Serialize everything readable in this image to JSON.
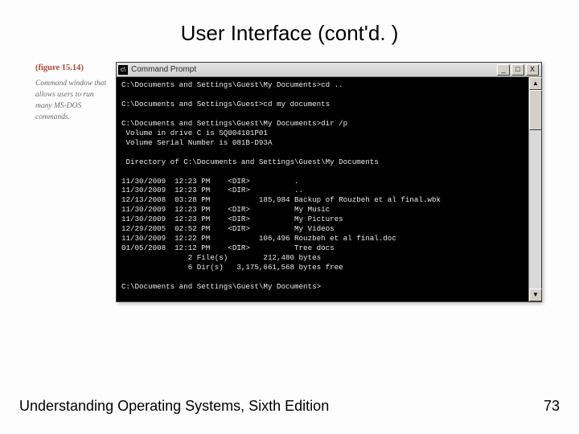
{
  "slide": {
    "title": "User Interface (cont'd. )",
    "footer_left": "Understanding Operating Systems, Sixth Edition",
    "footer_right": "73"
  },
  "figure": {
    "number": "(figure 15.14)",
    "caption": "Command window that allows users to run many MS-DOS commands."
  },
  "window": {
    "icon_glyph": "c\\",
    "title": "Command Prompt",
    "btn_min": "_",
    "btn_max": "□",
    "btn_close": "X",
    "scroll_up": "▲",
    "scroll_down": "▼"
  },
  "terminal": {
    "text": "C:\\Documents and Settings\\Guest\\My Documents>cd ..\n\nC:\\Documents and Settings\\Guest>cd my documents\n\nC:\\Documents and Settings\\Guest\\My Documents>dir /p\n Volume in drive C is SQ004101P01\n Volume Serial Number is 081B-D93A\n\n Directory of C:\\Documents and Settings\\Guest\\My Documents\n\n11/30/2009  12:23 PM    <DIR>          .\n11/30/2009  12:23 PM    <DIR>          ..\n12/13/2008  03:28 PM           185,984 Backup of Rouzbeh et al final.wbk\n11/30/2009  12:23 PM    <DIR>          My Music\n11/30/2009  12:23 PM    <DIR>          My Pictures\n12/29/2005  02:52 PM    <DIR>          My Videos\n11/30/2009  12:22 PM           106,496 Rouzbeh et al final.doc\n01/05/2008  12:12 PM    <DIR>          Tree docs\n               2 File(s)        212,480 bytes\n               6 Dir(s)   3,175,661,568 bytes free\n\nC:\\Documents and Settings\\Guest\\My Documents>"
  }
}
